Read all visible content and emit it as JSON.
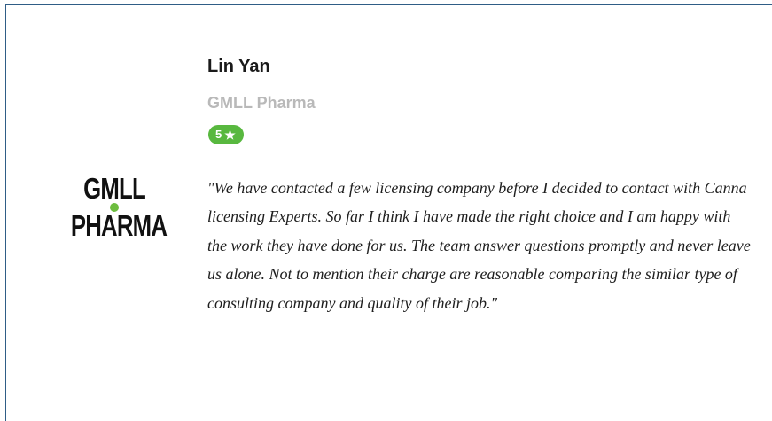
{
  "testimonial": {
    "name": "Lin Yan",
    "company": "GMLL Pharma",
    "rating": {
      "value": "5",
      "icon": "star-icon"
    },
    "quote": "\"We have contacted a few licensing company before I decided to contact with Canna licensing Experts. So far I think I have made the right choice and I am happy with the work they have done for us. The team answer questions promptly and never leave us alone. Not to mention their charge are reasonable comparing the similar type of consulting company and quality of their job.\""
  },
  "logo": {
    "line1": "GMLL",
    "line2": "PHARMA",
    "dot_color": "#6dbd3f"
  },
  "colors": {
    "frame_border": "#2f5d86",
    "rating_badge": "#58b83f",
    "company_text": "#b9b9b9"
  }
}
